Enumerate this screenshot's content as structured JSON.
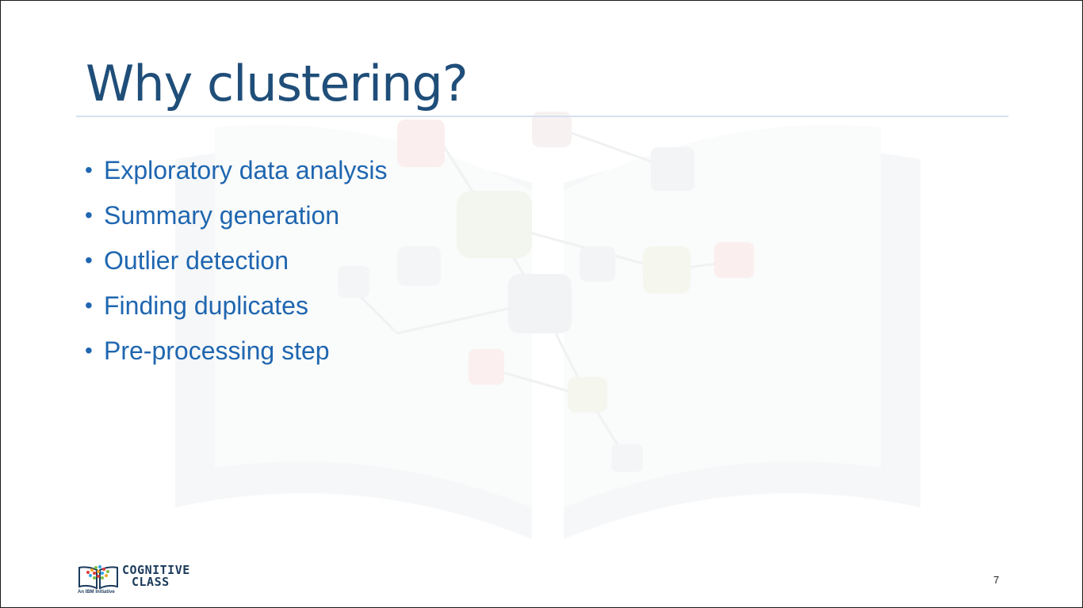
{
  "slide": {
    "title": "Why clustering?",
    "bullets": [
      "Exploratory data analysis",
      "Summary generation",
      "Outlier detection",
      "Finding duplicates",
      "Pre-processing step"
    ],
    "page_number": "7"
  },
  "logo": {
    "line1": "COGNITIVE",
    "line2": "CLASS",
    "tagline": "An IBM Initiative"
  },
  "colors": {
    "title": "#1f4e79",
    "bullets": "#1f66b0",
    "rule": "#d6e0f0"
  }
}
